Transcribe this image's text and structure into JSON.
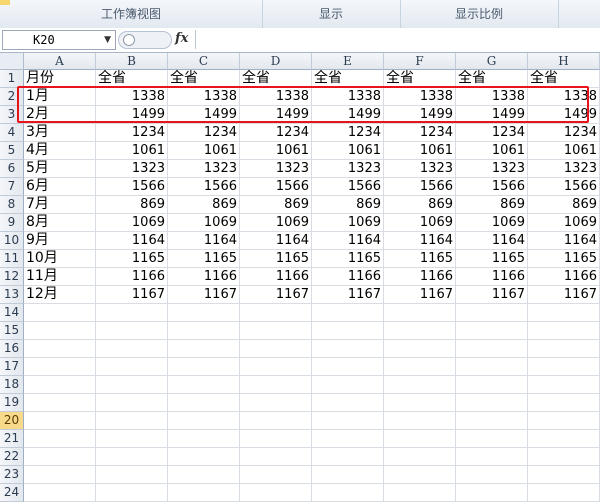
{
  "ribbon": {
    "groups": [
      "工作簿视图",
      "显示",
      "显示比例"
    ]
  },
  "formula_bar": {
    "name_box": "K20",
    "fx_label": "fx",
    "formula": ""
  },
  "columns": [
    "A",
    "B",
    "C",
    "D",
    "E",
    "F",
    "G",
    "H"
  ],
  "rows": [
    {
      "n": "1",
      "cells": [
        "月份",
        "全省",
        "全省",
        "全省",
        "全省",
        "全省",
        "全省",
        "全省"
      ]
    },
    {
      "n": "2",
      "cells": [
        "1月",
        "1338",
        "1338",
        "1338",
        "1338",
        "1338",
        "1338",
        "1338"
      ]
    },
    {
      "n": "3",
      "cells": [
        "2月",
        "1499",
        "1499",
        "1499",
        "1499",
        "1499",
        "1499",
        "1499"
      ]
    },
    {
      "n": "4",
      "cells": [
        "3月",
        "1234",
        "1234",
        "1234",
        "1234",
        "1234",
        "1234",
        "1234"
      ]
    },
    {
      "n": "5",
      "cells": [
        "4月",
        "1061",
        "1061",
        "1061",
        "1061",
        "1061",
        "1061",
        "1061"
      ]
    },
    {
      "n": "6",
      "cells": [
        "5月",
        "1323",
        "1323",
        "1323",
        "1323",
        "1323",
        "1323",
        "1323"
      ]
    },
    {
      "n": "7",
      "cells": [
        "6月",
        "1566",
        "1566",
        "1566",
        "1566",
        "1566",
        "1566",
        "1566"
      ]
    },
    {
      "n": "8",
      "cells": [
        "7月",
        "869",
        "869",
        "869",
        "869",
        "869",
        "869",
        "869"
      ]
    },
    {
      "n": "9",
      "cells": [
        "8月",
        "1069",
        "1069",
        "1069",
        "1069",
        "1069",
        "1069",
        "1069"
      ]
    },
    {
      "n": "10",
      "cells": [
        "9月",
        "1164",
        "1164",
        "1164",
        "1164",
        "1164",
        "1164",
        "1164"
      ]
    },
    {
      "n": "11",
      "cells": [
        "10月",
        "1165",
        "1165",
        "1165",
        "1165",
        "1165",
        "1165",
        "1165"
      ]
    },
    {
      "n": "12",
      "cells": [
        "11月",
        "1166",
        "1166",
        "1166",
        "1166",
        "1166",
        "1166",
        "1166"
      ]
    },
    {
      "n": "13",
      "cells": [
        "12月",
        "1167",
        "1167",
        "1167",
        "1167",
        "1167",
        "1167",
        "1167"
      ]
    },
    {
      "n": "14",
      "cells": [
        "",
        "",
        "",
        "",
        "",
        "",
        "",
        ""
      ]
    },
    {
      "n": "15",
      "cells": [
        "",
        "",
        "",
        "",
        "",
        "",
        "",
        ""
      ]
    },
    {
      "n": "16",
      "cells": [
        "",
        "",
        "",
        "",
        "",
        "",
        "",
        ""
      ]
    },
    {
      "n": "17",
      "cells": [
        "",
        "",
        "",
        "",
        "",
        "",
        "",
        ""
      ]
    },
    {
      "n": "18",
      "cells": [
        "",
        "",
        "",
        "",
        "",
        "",
        "",
        ""
      ]
    },
    {
      "n": "19",
      "cells": [
        "",
        "",
        "",
        "",
        "",
        "",
        "",
        ""
      ]
    },
    {
      "n": "20",
      "cells": [
        "",
        "",
        "",
        "",
        "",
        "",
        "",
        ""
      ]
    },
    {
      "n": "21",
      "cells": [
        "",
        "",
        "",
        "",
        "",
        "",
        "",
        ""
      ]
    },
    {
      "n": "22",
      "cells": [
        "",
        "",
        "",
        "",
        "",
        "",
        "",
        ""
      ]
    },
    {
      "n": "23",
      "cells": [
        "",
        "",
        "",
        "",
        "",
        "",
        "",
        ""
      ]
    },
    {
      "n": "24",
      "cells": [
        "",
        "",
        "",
        "",
        "",
        "",
        "",
        ""
      ]
    }
  ],
  "active_row": "20",
  "highlight_color": "#e8141a"
}
